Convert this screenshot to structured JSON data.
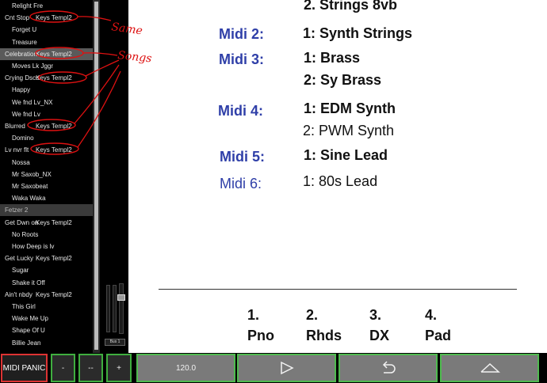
{
  "songlist": {
    "rows": [
      {
        "type": "song",
        "label": "Relight Fre",
        "template": ""
      },
      {
        "type": "set",
        "label": "Cnt Stop",
        "template": "Keys Templ2"
      },
      {
        "type": "song",
        "label": "Forget U",
        "template": ""
      },
      {
        "type": "song",
        "label": "Treasure",
        "template": ""
      },
      {
        "type": "set",
        "label": "Celebration",
        "template": "Keys Templ2",
        "selected": true
      },
      {
        "type": "song",
        "label": "Moves Lk Jggr",
        "template": ""
      },
      {
        "type": "set",
        "label": "Crying Dsco",
        "template": "Keys Templ2"
      },
      {
        "type": "song",
        "label": "Happy",
        "template": ""
      },
      {
        "type": "song",
        "label": "We fnd Lv_NX",
        "template": ""
      },
      {
        "type": "song",
        "label": "We fnd Lv",
        "template": ""
      },
      {
        "type": "set",
        "label": "Blurred",
        "template": "Keys Templ2"
      },
      {
        "type": "song",
        "label": "Domino",
        "template": ""
      },
      {
        "type": "set",
        "label": "Lv nvr flt",
        "template": "Keys Templ2"
      },
      {
        "type": "song",
        "label": "Nossa",
        "template": ""
      },
      {
        "type": "song",
        "label": "Mr Saxob_NX",
        "template": ""
      },
      {
        "type": "song",
        "label": "Mr Saxobeat",
        "template": ""
      },
      {
        "type": "song",
        "label": "Waka Waka",
        "template": ""
      },
      {
        "type": "header",
        "label": "Fetzer 2",
        "template": ""
      },
      {
        "type": "set",
        "label": "Get Dwn on",
        "template": "Keys Templ2"
      },
      {
        "type": "song",
        "label": "No Roots",
        "template": ""
      },
      {
        "type": "song",
        "label": "How Deep is lv",
        "template": ""
      },
      {
        "type": "set",
        "label": "Get Lucky",
        "template": "Keys Templ2"
      },
      {
        "type": "song",
        "label": "Sugar",
        "template": ""
      },
      {
        "type": "song",
        "label": "Shake it Off",
        "template": ""
      },
      {
        "type": "set",
        "label": "Ain't nbdy",
        "template": "Keys Templ2"
      },
      {
        "type": "song",
        "label": "This Girl",
        "template": ""
      },
      {
        "type": "song",
        "label": "Wake Me Up",
        "template": ""
      },
      {
        "type": "song",
        "label": "Shape Of U",
        "template": ""
      },
      {
        "type": "song",
        "label": "Billie Jean",
        "template": ""
      }
    ]
  },
  "mixer": {
    "bus_label": "Bus 1"
  },
  "document": {
    "top_partial": "2. Strings 8vb",
    "midi": [
      {
        "label": "Midi 2:",
        "bold": true,
        "patches": [
          {
            "text": "1: Synth Strings",
            "bold": true
          }
        ]
      },
      {
        "label": "Midi 3:",
        "bold": true,
        "patches": [
          {
            "text": "1: Brass",
            "bold": true
          },
          {
            "text": "2: Sy Brass",
            "bold": true
          }
        ]
      },
      {
        "label": "Midi 4:",
        "bold": true,
        "patches": [
          {
            "text": "1: EDM Synth",
            "bold": true
          },
          {
            "text": "2: PWM Synth",
            "bold": false
          }
        ]
      },
      {
        "label": "Midi 5:",
        "bold": true,
        "patches": [
          {
            "text": "1: Sine Lead",
            "bold": true
          }
        ]
      },
      {
        "label": "Midi 6:",
        "bold": false,
        "patches": [
          {
            "text": "1: 80s Lead",
            "bold": false
          }
        ]
      }
    ],
    "footer": [
      {
        "num": "1.",
        "name": "Pno"
      },
      {
        "num": "2.",
        "name": "Rhds"
      },
      {
        "num": "3.",
        "name": "DX"
      },
      {
        "num": "4.",
        "name": "Pad"
      }
    ]
  },
  "toolbar": {
    "panic_label": "MIDI PANIC",
    "minus_label": "-",
    "minusminus_label": "--",
    "plus_label": "+",
    "tempo_label": "120.0",
    "play_icon": "play-icon",
    "loop_icon": "undo-icon",
    "up_icon": "chevron-up-icon"
  },
  "annotations": {
    "same": "Same",
    "songs": "Songs"
  },
  "colors": {
    "accent_green": "#3fae3f",
    "midi_blue": "#2f3fa8",
    "annotation_red": "#d11111"
  }
}
